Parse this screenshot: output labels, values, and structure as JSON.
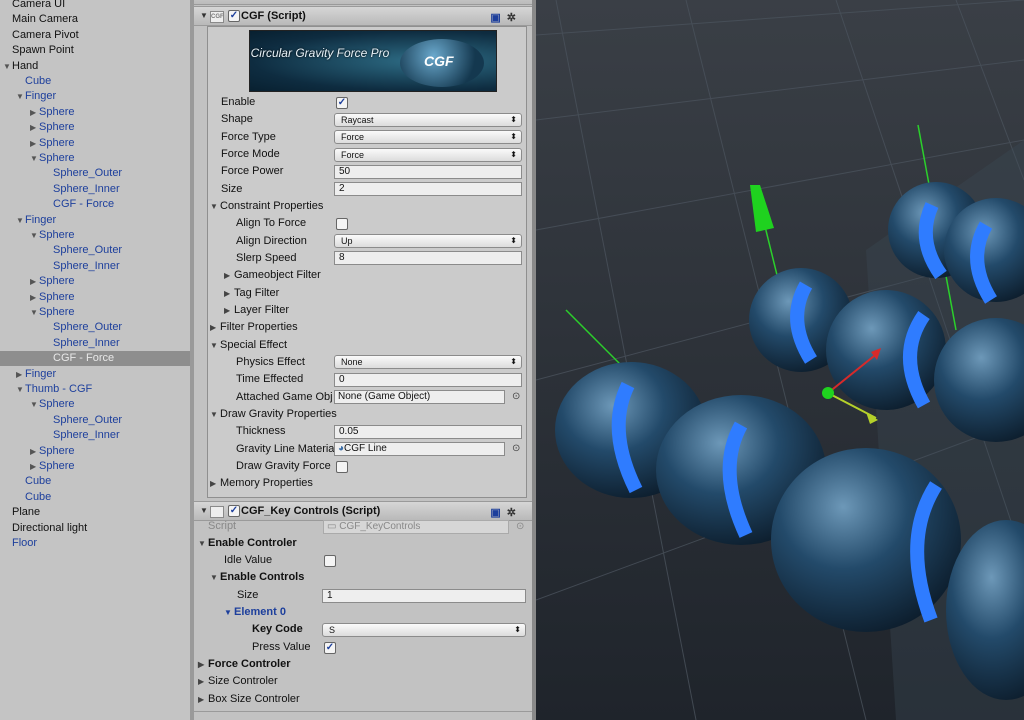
{
  "hierarchy": {
    "items": [
      {
        "label": "Camera UI",
        "depth": 0,
        "tri": "",
        "blue": false
      },
      {
        "label": "Main Camera",
        "depth": 0,
        "tri": "",
        "blue": false
      },
      {
        "label": "Camera Pivot",
        "depth": 0,
        "tri": "",
        "blue": false
      },
      {
        "label": "Spawn Point",
        "depth": 0,
        "tri": "",
        "blue": false
      },
      {
        "label": "Hand",
        "depth": 0,
        "tri": "▼",
        "blue": false
      },
      {
        "label": "Cube",
        "depth": 1,
        "tri": "",
        "blue": true
      },
      {
        "label": "Finger",
        "depth": 1,
        "tri": "▼",
        "blue": true
      },
      {
        "label": "Sphere",
        "depth": 2,
        "tri": "▶",
        "blue": true
      },
      {
        "label": "Sphere",
        "depth": 2,
        "tri": "▶",
        "blue": true
      },
      {
        "label": "Sphere",
        "depth": 2,
        "tri": "▶",
        "blue": true
      },
      {
        "label": "Sphere",
        "depth": 2,
        "tri": "▼",
        "blue": true
      },
      {
        "label": "Sphere_Outer",
        "depth": 3,
        "tri": "",
        "blue": true
      },
      {
        "label": "Sphere_Inner",
        "depth": 3,
        "tri": "",
        "blue": true
      },
      {
        "label": "CGF - Force",
        "depth": 3,
        "tri": "",
        "blue": true
      },
      {
        "label": "Finger",
        "depth": 1,
        "tri": "▼",
        "blue": true
      },
      {
        "label": "Sphere",
        "depth": 2,
        "tri": "▼",
        "blue": true
      },
      {
        "label": "Sphere_Outer",
        "depth": 3,
        "tri": "",
        "blue": true
      },
      {
        "label": "Sphere_Inner",
        "depth": 3,
        "tri": "",
        "blue": true
      },
      {
        "label": "Sphere",
        "depth": 2,
        "tri": "▶",
        "blue": true
      },
      {
        "label": "Sphere",
        "depth": 2,
        "tri": "▶",
        "blue": true
      },
      {
        "label": "Sphere",
        "depth": 2,
        "tri": "▼",
        "blue": true
      },
      {
        "label": "Sphere_Outer",
        "depth": 3,
        "tri": "",
        "blue": true
      },
      {
        "label": "Sphere_Inner",
        "depth": 3,
        "tri": "",
        "blue": true
      },
      {
        "label": "CGF - Force",
        "depth": 3,
        "tri": "",
        "blue": true,
        "selected": true
      },
      {
        "label": "Finger",
        "depth": 1,
        "tri": "▶",
        "blue": true
      },
      {
        "label": "Thumb - CGF",
        "depth": 1,
        "tri": "▼",
        "blue": true
      },
      {
        "label": "Sphere",
        "depth": 2,
        "tri": "▼",
        "blue": true
      },
      {
        "label": "Sphere_Outer",
        "depth": 3,
        "tri": "",
        "blue": true
      },
      {
        "label": "Sphere_Inner",
        "depth": 3,
        "tri": "",
        "blue": true
      },
      {
        "label": "Sphere",
        "depth": 2,
        "tri": "▶",
        "blue": true
      },
      {
        "label": "Sphere",
        "depth": 2,
        "tri": "▶",
        "blue": true
      },
      {
        "label": "Cube",
        "depth": 1,
        "tri": "",
        "blue": true
      },
      {
        "label": "Cube",
        "depth": 1,
        "tri": "",
        "blue": true
      },
      {
        "label": "Plane",
        "depth": 0,
        "tri": "",
        "blue": false
      },
      {
        "label": "Directional light",
        "depth": 0,
        "tri": "",
        "blue": false
      },
      {
        "label": "Floor",
        "depth": 0,
        "tri": "",
        "blue": true
      }
    ]
  },
  "inspector": {
    "cgf": {
      "header": "CGF (Script)",
      "icon_text": "CGF",
      "banner_title": "Circular Gravity Force Pro",
      "banner_logo": "CGF",
      "enable": "Enable",
      "shape": {
        "label": "Shape",
        "value": "Raycast"
      },
      "force_type": {
        "label": "Force Type",
        "value": "Force"
      },
      "force_mode": {
        "label": "Force Mode",
        "value": "Force"
      },
      "force_power": {
        "label": "Force Power",
        "value": "50"
      },
      "size": {
        "label": "Size",
        "value": "2"
      },
      "constraint": "Constraint Properties",
      "align_to_force": "Align To Force",
      "align_direction": {
        "label": "Align Direction",
        "value": "Up"
      },
      "slerp_speed": {
        "label": "Slerp Speed",
        "value": "8"
      },
      "gameobject_filter": "Gameobject Filter",
      "tag_filter": "Tag Filter",
      "layer_filter": "Layer Filter",
      "filter_properties": "Filter Properties",
      "special_effect": "Special Effect",
      "physics_effect": {
        "label": "Physics Effect",
        "value": "None"
      },
      "time_effected": {
        "label": "Time Effected",
        "value": "0"
      },
      "attached_game_obj": {
        "label": "Attached Game Obj",
        "value": "None (Game Object)"
      },
      "draw_gravity": "Draw Gravity Properties",
      "thickness": {
        "label": "Thickness",
        "value": "0.05"
      },
      "gravity_line_material": {
        "label": "Gravity Line Materia",
        "value": "CGF Line"
      },
      "draw_gravity_force": "Draw Gravity Force",
      "memory_properties": "Memory Properties"
    },
    "key": {
      "header": "CGF_Key Controls (Script)",
      "script": {
        "label": "Script",
        "value": "CGF_KeyControls"
      },
      "enable_controler": "Enable Controler",
      "idle_value": "Idle Value",
      "enable_controls": "Enable Controls",
      "size": {
        "label": "Size",
        "value": "1"
      },
      "element0": "Element 0",
      "key_code": {
        "label": "Key Code",
        "value": "S"
      },
      "press_value": "Press Value",
      "force_controler": "Force Controler",
      "size_controler": "Size Controler",
      "box_size_controler": "Box Size Controler"
    }
  },
  "colors": {
    "accent": "#1d3f9c",
    "ring": "#2f7cff",
    "sphere": "#1b3d5a",
    "grid": "#2a313a"
  }
}
